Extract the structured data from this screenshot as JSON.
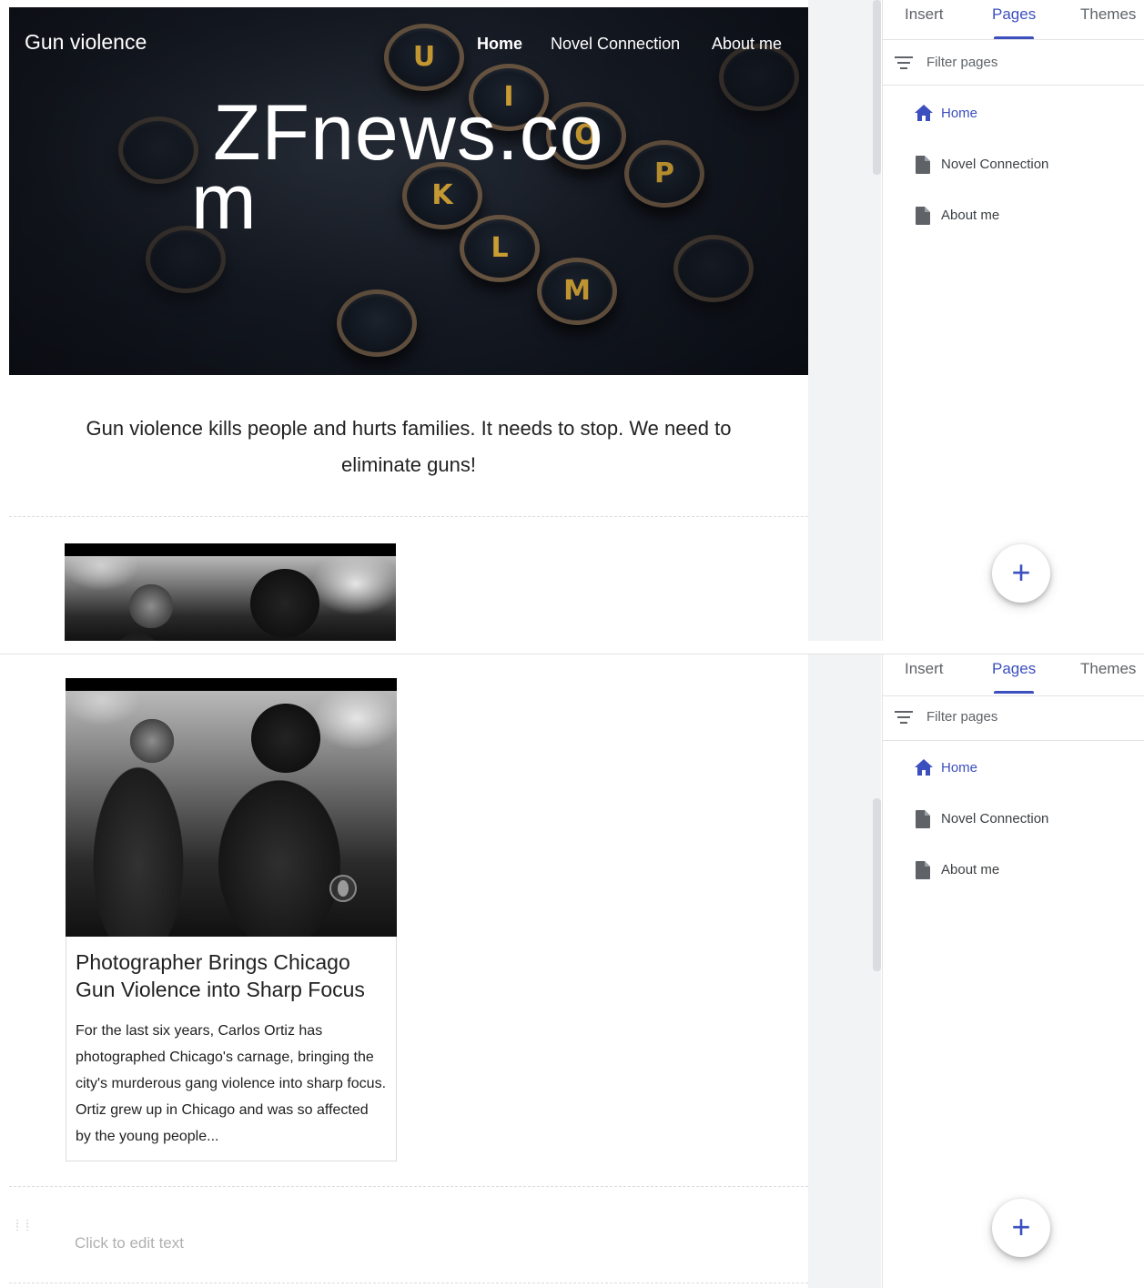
{
  "site": {
    "title": "Gun violence",
    "nav": [
      "Home",
      "Novel Connection",
      "About me"
    ],
    "hero_heading": "ZFnews.com",
    "intro": "Gun  violence kills people and hurts families.  It needs to stop.  We need to eliminate guns!",
    "card": {
      "title": "Photographer Brings Chicago Gun Violence into Sharp Focus",
      "excerpt": "For the last six years, Carlos Ortiz has photographed Chicago's carnage, bringing the city's murderous gang violence into sharp focus. Ortiz grew up in Chicago and was so affected by the young people..."
    },
    "placeholder": "Click to edit text",
    "typewriter_keys": [
      "U",
      "I",
      "O",
      "P",
      "K",
      "L",
      "M"
    ]
  },
  "panel": {
    "tabs": [
      "Insert",
      "Pages",
      "Themes"
    ],
    "active_tab": "Pages",
    "filter_placeholder": "Filter pages",
    "pages": [
      "Home",
      "Novel Connection",
      "About me"
    ],
    "active_page": "Home",
    "fab_label": "+"
  },
  "colors": {
    "accent": "#3c4fbf",
    "text_muted": "#5f6368",
    "key_legend": "#d6a636"
  },
  "icons": {
    "filter": "filter-icon",
    "home": "home-icon",
    "page": "page-icon",
    "add": "add-icon",
    "drag": "drag-handle-icon",
    "network_logo": "cbs-eye-logo"
  }
}
